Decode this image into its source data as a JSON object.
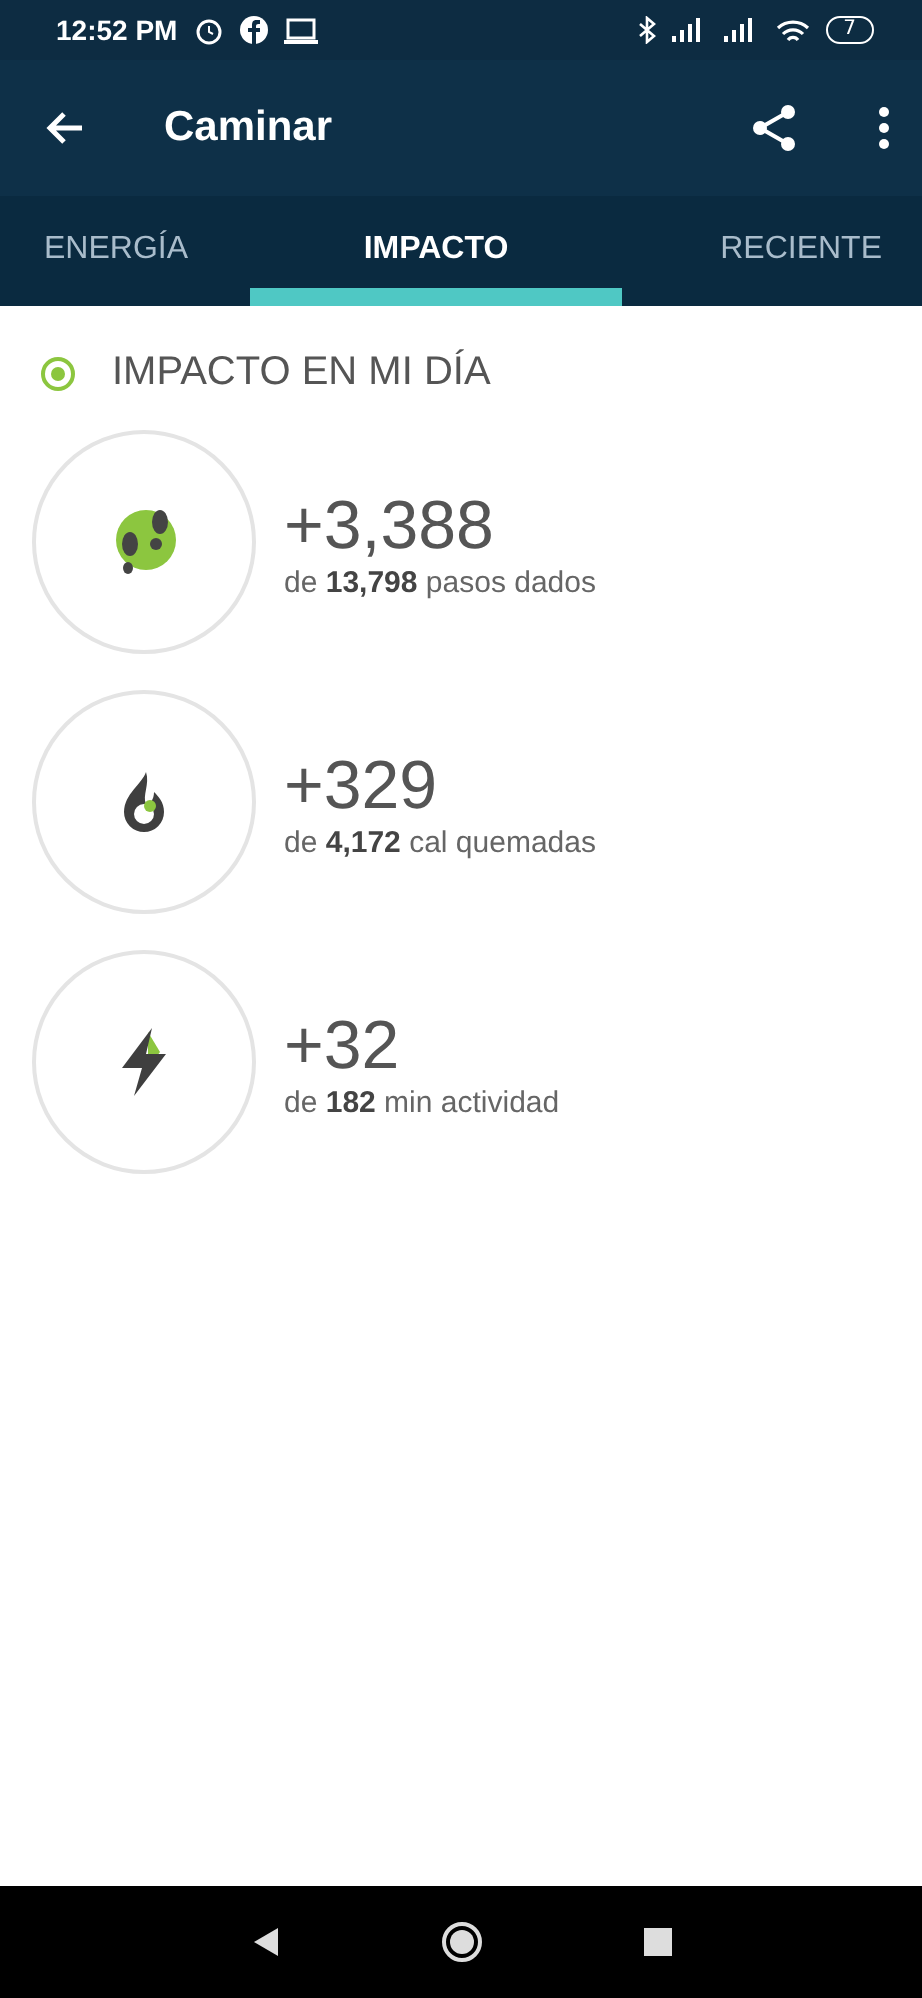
{
  "status_bar": {
    "time": "12:52 PM",
    "battery": "7"
  },
  "app_bar": {
    "title": "Caminar"
  },
  "tabs": [
    {
      "label": "ENERGÍA",
      "selected": false
    },
    {
      "label": "IMPACTO",
      "selected": true
    },
    {
      "label": "RECIENTE",
      "selected": false
    }
  ],
  "section": {
    "title": "IMPACTO EN MI DÍA"
  },
  "metrics": [
    {
      "kind": "steps",
      "value": "+3,388",
      "detail": "de **13,798** pasos dados"
    },
    {
      "kind": "calories",
      "value": "+329",
      "detail": "de **4,172** cal quemadas"
    },
    {
      "kind": "active",
      "value": "+32",
      "detail": "de **182** min actividad"
    }
  ]
}
